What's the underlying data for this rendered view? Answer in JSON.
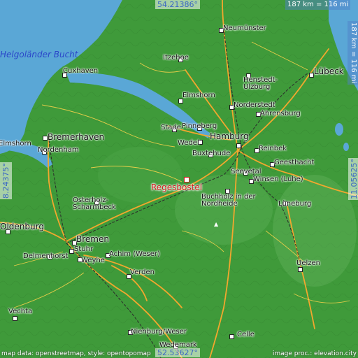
{
  "map": {
    "colors": {
      "land": "#3f9a3a",
      "water": "#5aa7d6",
      "road": "#f2a72e",
      "rail": "#2b2b2b",
      "highlight": "#d01a1a"
    },
    "highlight_place": "Regesbostel",
    "water_label": "Helgoländer Bucht",
    "places": [
      "Neumünster",
      "Itzehoe",
      "Lübeck",
      "Cuxhaven",
      "Henstedt-Ulzburg",
      "Elmshorn",
      "Norderstedt",
      "Ahrensburg",
      "Bremerhaven",
      "Stade",
      "Pinneberg",
      "Hamburg",
      "Nordenham",
      "Wedel",
      "Buxtehude",
      "Reinbek",
      "Geesthacht",
      "Seevetal",
      "Winsen (Luhe)",
      "Buchholz in der Nordheide",
      "Osterholz-Scharmbeck",
      "Lüneburg",
      "Oldenburg",
      "Bremen",
      "Stuhr",
      "Delmenhorst",
      "Weyhe",
      "Achim (Weser)",
      "Verden",
      "Uelzen",
      "Vechta",
      "Nienburg/Weser",
      "Wedemark",
      "Celle"
    ],
    "edge_fragments": [
      "Elmshorn"
    ]
  },
  "overlay": {
    "lat_top": "54.21386°",
    "lat_bottom": "52.53627°",
    "lon_left": "8.24375°",
    "lon_right": "11.05625°",
    "scale_top": "187 km = 116 mi",
    "scale_right": "187 km = 116 mi",
    "credit_left": "map data: openstreetmap, style: opentopomap",
    "credit_right": "image proc.: elevation.city"
  }
}
